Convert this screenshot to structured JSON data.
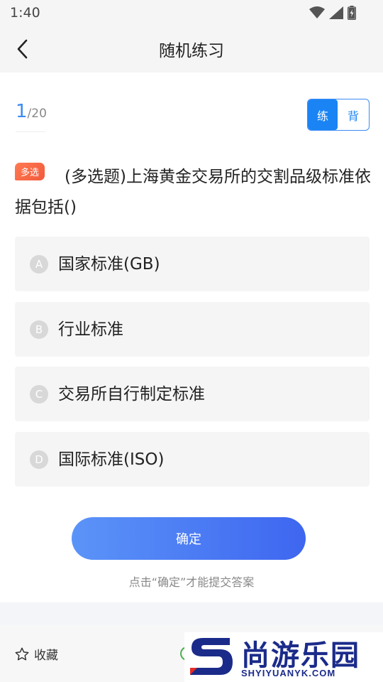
{
  "status_bar": {
    "time": "1:40",
    "icons": [
      "wifi-icon",
      "signal-icon",
      "battery-icon"
    ]
  },
  "nav": {
    "title": "随机练习",
    "back_icon": "chevron-left-icon"
  },
  "progress": {
    "current": "1",
    "total": "/20"
  },
  "mode_toggle": {
    "practice_label": "练",
    "recite_label": "背",
    "active": "practice"
  },
  "question": {
    "type_badge": "多选",
    "text": "(多选题)上海黄金交易所的交割品级标准依据包括()"
  },
  "options": [
    {
      "letter": "A",
      "text": "国家标准(GB)"
    },
    {
      "letter": "B",
      "text": "行业标准"
    },
    {
      "letter": "C",
      "text": "交易所自行制定标准"
    },
    {
      "letter": "D",
      "text": "国际标准(ISO)"
    }
  ],
  "actions": {
    "confirm_label": "确定",
    "hint": "点击“确定”才能提交答案"
  },
  "bottom_bar": {
    "favorite_label": "收藏",
    "favorite_icon": "star-outline-icon"
  },
  "watermark": {
    "cn": "尚游乐园",
    "en": "SHYIYUANYK.COM"
  },
  "colors": {
    "accent": "#1a84f5",
    "badge": "#f25a3c",
    "button_start": "#5b94f8",
    "button_end": "#3e66f0",
    "option_bg": "#f5f5f5"
  }
}
